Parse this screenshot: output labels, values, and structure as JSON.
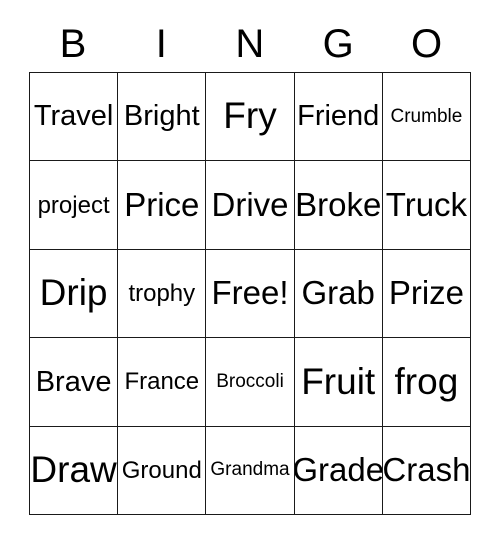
{
  "card": {
    "title": "BINGO",
    "headers": [
      "B",
      "I",
      "N",
      "G",
      "O"
    ],
    "border_color": "#1a1a1a",
    "background_color": "#ffffff",
    "text_color": "#000000",
    "rows": [
      [
        {
          "label": "Travel",
          "size": "md"
        },
        {
          "label": "Bright",
          "size": "md"
        },
        {
          "label": "Fry",
          "size": "xl"
        },
        {
          "label": "Friend",
          "size": "md"
        },
        {
          "label": "Crumble",
          "size": "xs"
        }
      ],
      [
        {
          "label": "project",
          "size": "sm"
        },
        {
          "label": "Price",
          "size": "lg"
        },
        {
          "label": "Drive",
          "size": "lg"
        },
        {
          "label": "Broke",
          "size": "lg"
        },
        {
          "label": "Truck",
          "size": "lg"
        }
      ],
      [
        {
          "label": "Drip",
          "size": "xl"
        },
        {
          "label": "trophy",
          "size": "sm"
        },
        {
          "label": "Free!",
          "size": "lg"
        },
        {
          "label": "Grab",
          "size": "lg"
        },
        {
          "label": "Prize",
          "size": "lg"
        }
      ],
      [
        {
          "label": "Brave",
          "size": "md"
        },
        {
          "label": "France",
          "size": "sm"
        },
        {
          "label": "Broccoli",
          "size": "xs"
        },
        {
          "label": "Fruit",
          "size": "xl"
        },
        {
          "label": "frog",
          "size": "xl"
        }
      ],
      [
        {
          "label": "Draw",
          "size": "xl"
        },
        {
          "label": "Ground",
          "size": "sm"
        },
        {
          "label": "Grandma",
          "size": "xs"
        },
        {
          "label": "Grade",
          "size": "lg"
        },
        {
          "label": "Crash",
          "size": "lg"
        }
      ]
    ]
  }
}
